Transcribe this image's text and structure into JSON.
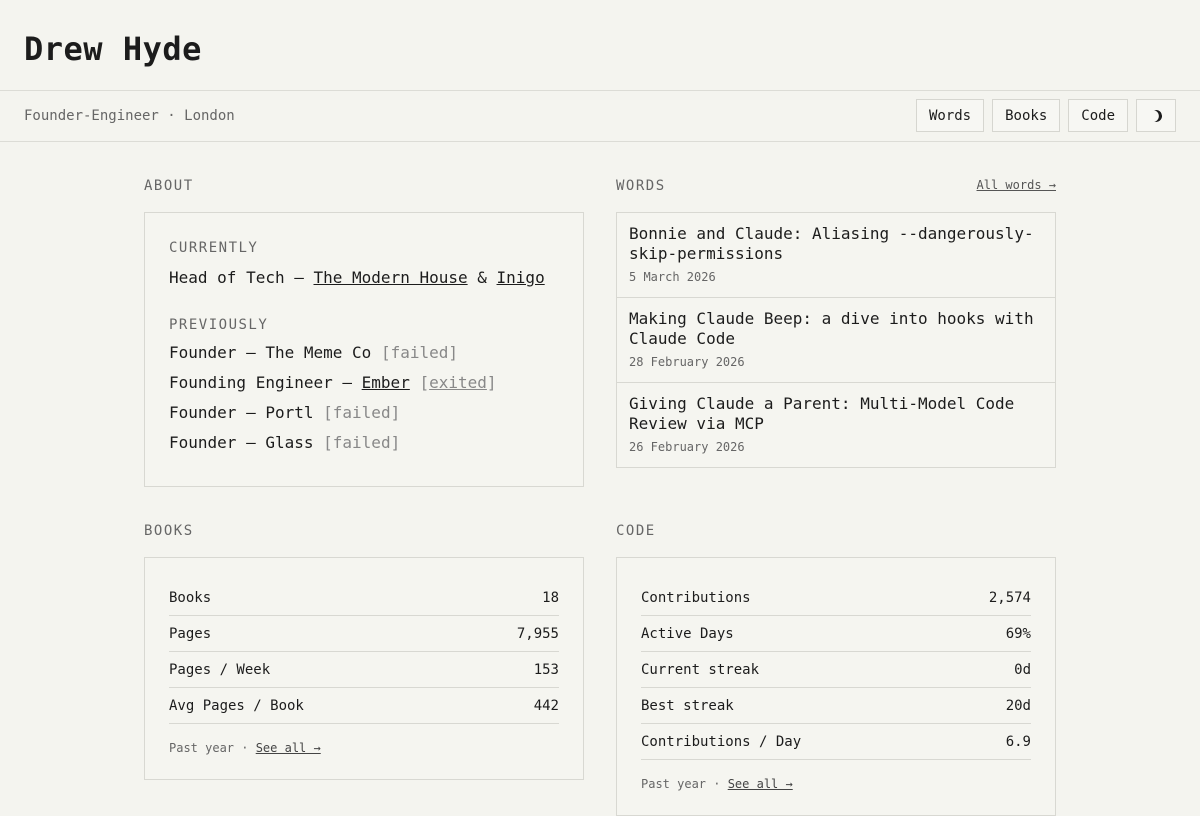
{
  "header": {
    "title": "Drew Hyde"
  },
  "subbar": {
    "tagline": "Founder-Engineer · London",
    "nav": [
      {
        "label": "Words"
      },
      {
        "label": "Books"
      },
      {
        "label": "Code"
      }
    ],
    "theme_icon": "moon-icon"
  },
  "about": {
    "label": "ABOUT",
    "currently_label": "CURRENTLY",
    "current_role": {
      "prefix": "Head of Tech — ",
      "company1": "The Modern House",
      "joiner": " & ",
      "company2": "Inigo"
    },
    "previously_label": "PREVIOUSLY",
    "previous": [
      {
        "role": "Founder — ",
        "company": "The Meme Co",
        "company_linked": false,
        "status": "[failed]",
        "status_linked": false
      },
      {
        "role": "Founding Engineer — ",
        "company": "Ember",
        "company_linked": true,
        "status": "[exited]",
        "status_linked": true
      },
      {
        "role": "Founder — ",
        "company": "Portl",
        "company_linked": false,
        "status": "[failed]",
        "status_linked": false
      },
      {
        "role": "Founder — ",
        "company": "Glass",
        "company_linked": false,
        "status": "[failed]",
        "status_linked": false
      }
    ]
  },
  "words": {
    "label": "WORDS",
    "all_link": "All words →",
    "posts": [
      {
        "title": "Bonnie and Claude: Aliasing --dangerously-skip-permissions",
        "date": "5 March 2026"
      },
      {
        "title": "Making Claude Beep: a dive into hooks with Claude Code",
        "date": "28 February 2026"
      },
      {
        "title": "Giving Claude a Parent: Multi-Model Code Review via MCP",
        "date": "26 February 2026"
      }
    ]
  },
  "books": {
    "label": "BOOKS",
    "stats": [
      {
        "name": "Books",
        "value": "18"
      },
      {
        "name": "Pages",
        "value": "7,955"
      },
      {
        "name": "Pages / Week",
        "value": "153"
      },
      {
        "name": "Avg Pages / Book",
        "value": "442"
      }
    ],
    "foot_text": "Past year · ",
    "foot_link": "See all →"
  },
  "code": {
    "label": "CODE",
    "stats": [
      {
        "name": "Contributions",
        "value": "2,574"
      },
      {
        "name": "Active Days",
        "value": "69%"
      },
      {
        "name": "Current streak",
        "value": "0d"
      },
      {
        "name": "Best streak",
        "value": "20d"
      },
      {
        "name": "Contributions / Day",
        "value": "6.9"
      }
    ],
    "foot_text": "Past year · ",
    "foot_link": "See all →"
  }
}
